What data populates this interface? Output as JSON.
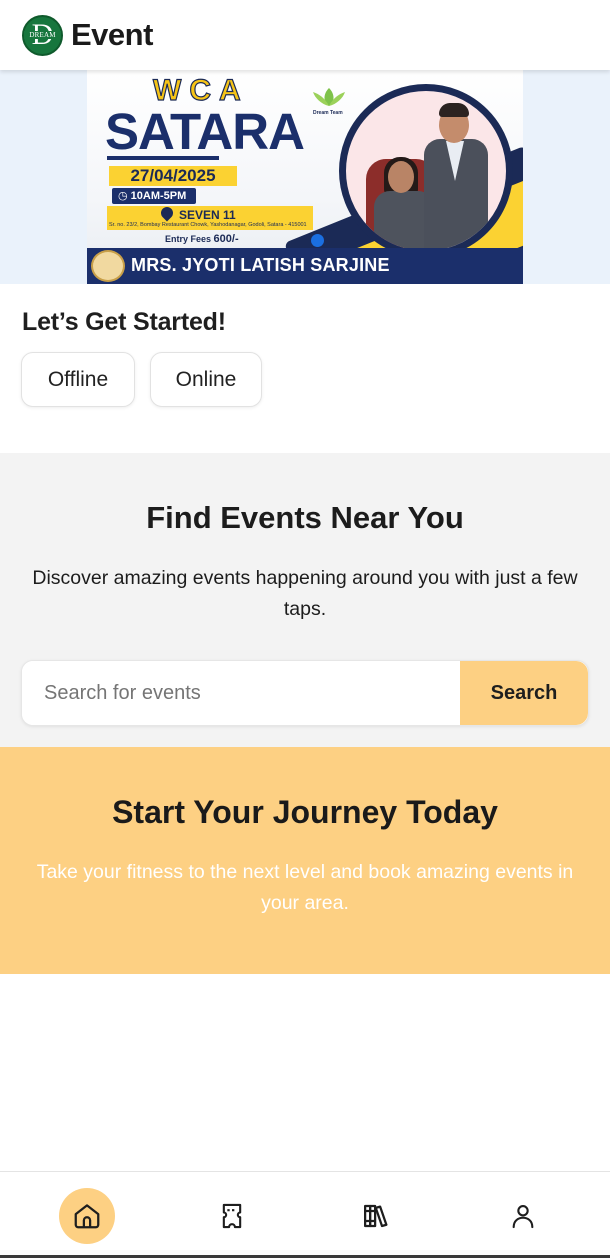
{
  "header": {
    "logo_text": "DREAM",
    "logo_letter": "D",
    "title": "Event"
  },
  "banner": {
    "org": "WCA",
    "city": "SATARA",
    "date": "27/04/2025",
    "time": "10AM-5PM",
    "venue": "SEVEN 11",
    "address": "Sr. no. 23/2, Bombay Restaurant Chowk, Yashodanagar, Godoli, Satara - 415001",
    "entry_fee_label": "Entry Fees",
    "entry_fee_value": "600/-",
    "team_label": "Dream Team",
    "host_name": "MRS. JYOTI LATISH SARJINE"
  },
  "get_started": {
    "title": "Let’s Get Started!",
    "offline_label": "Offline",
    "online_label": "Online"
  },
  "find_events": {
    "title": "Find Events Near You",
    "description": "Discover amazing events happening around you with just a few taps.",
    "search_placeholder": "Search for events",
    "search_button": "Search"
  },
  "journey": {
    "title": "Start Your Journey Today",
    "description": "Take your fitness to the next level and book amazing events in your area."
  },
  "bottom_nav": {
    "items": [
      {
        "icon": "home-icon",
        "active": true
      },
      {
        "icon": "ticket-icon",
        "active": false
      },
      {
        "icon": "library-icon",
        "active": false
      },
      {
        "icon": "user-icon",
        "active": false
      }
    ]
  },
  "colors": {
    "accent": "#fdd083",
    "brand_green": "#17763d",
    "banner_navy": "#1b2f6b",
    "banner_yellow": "#fbd232"
  }
}
